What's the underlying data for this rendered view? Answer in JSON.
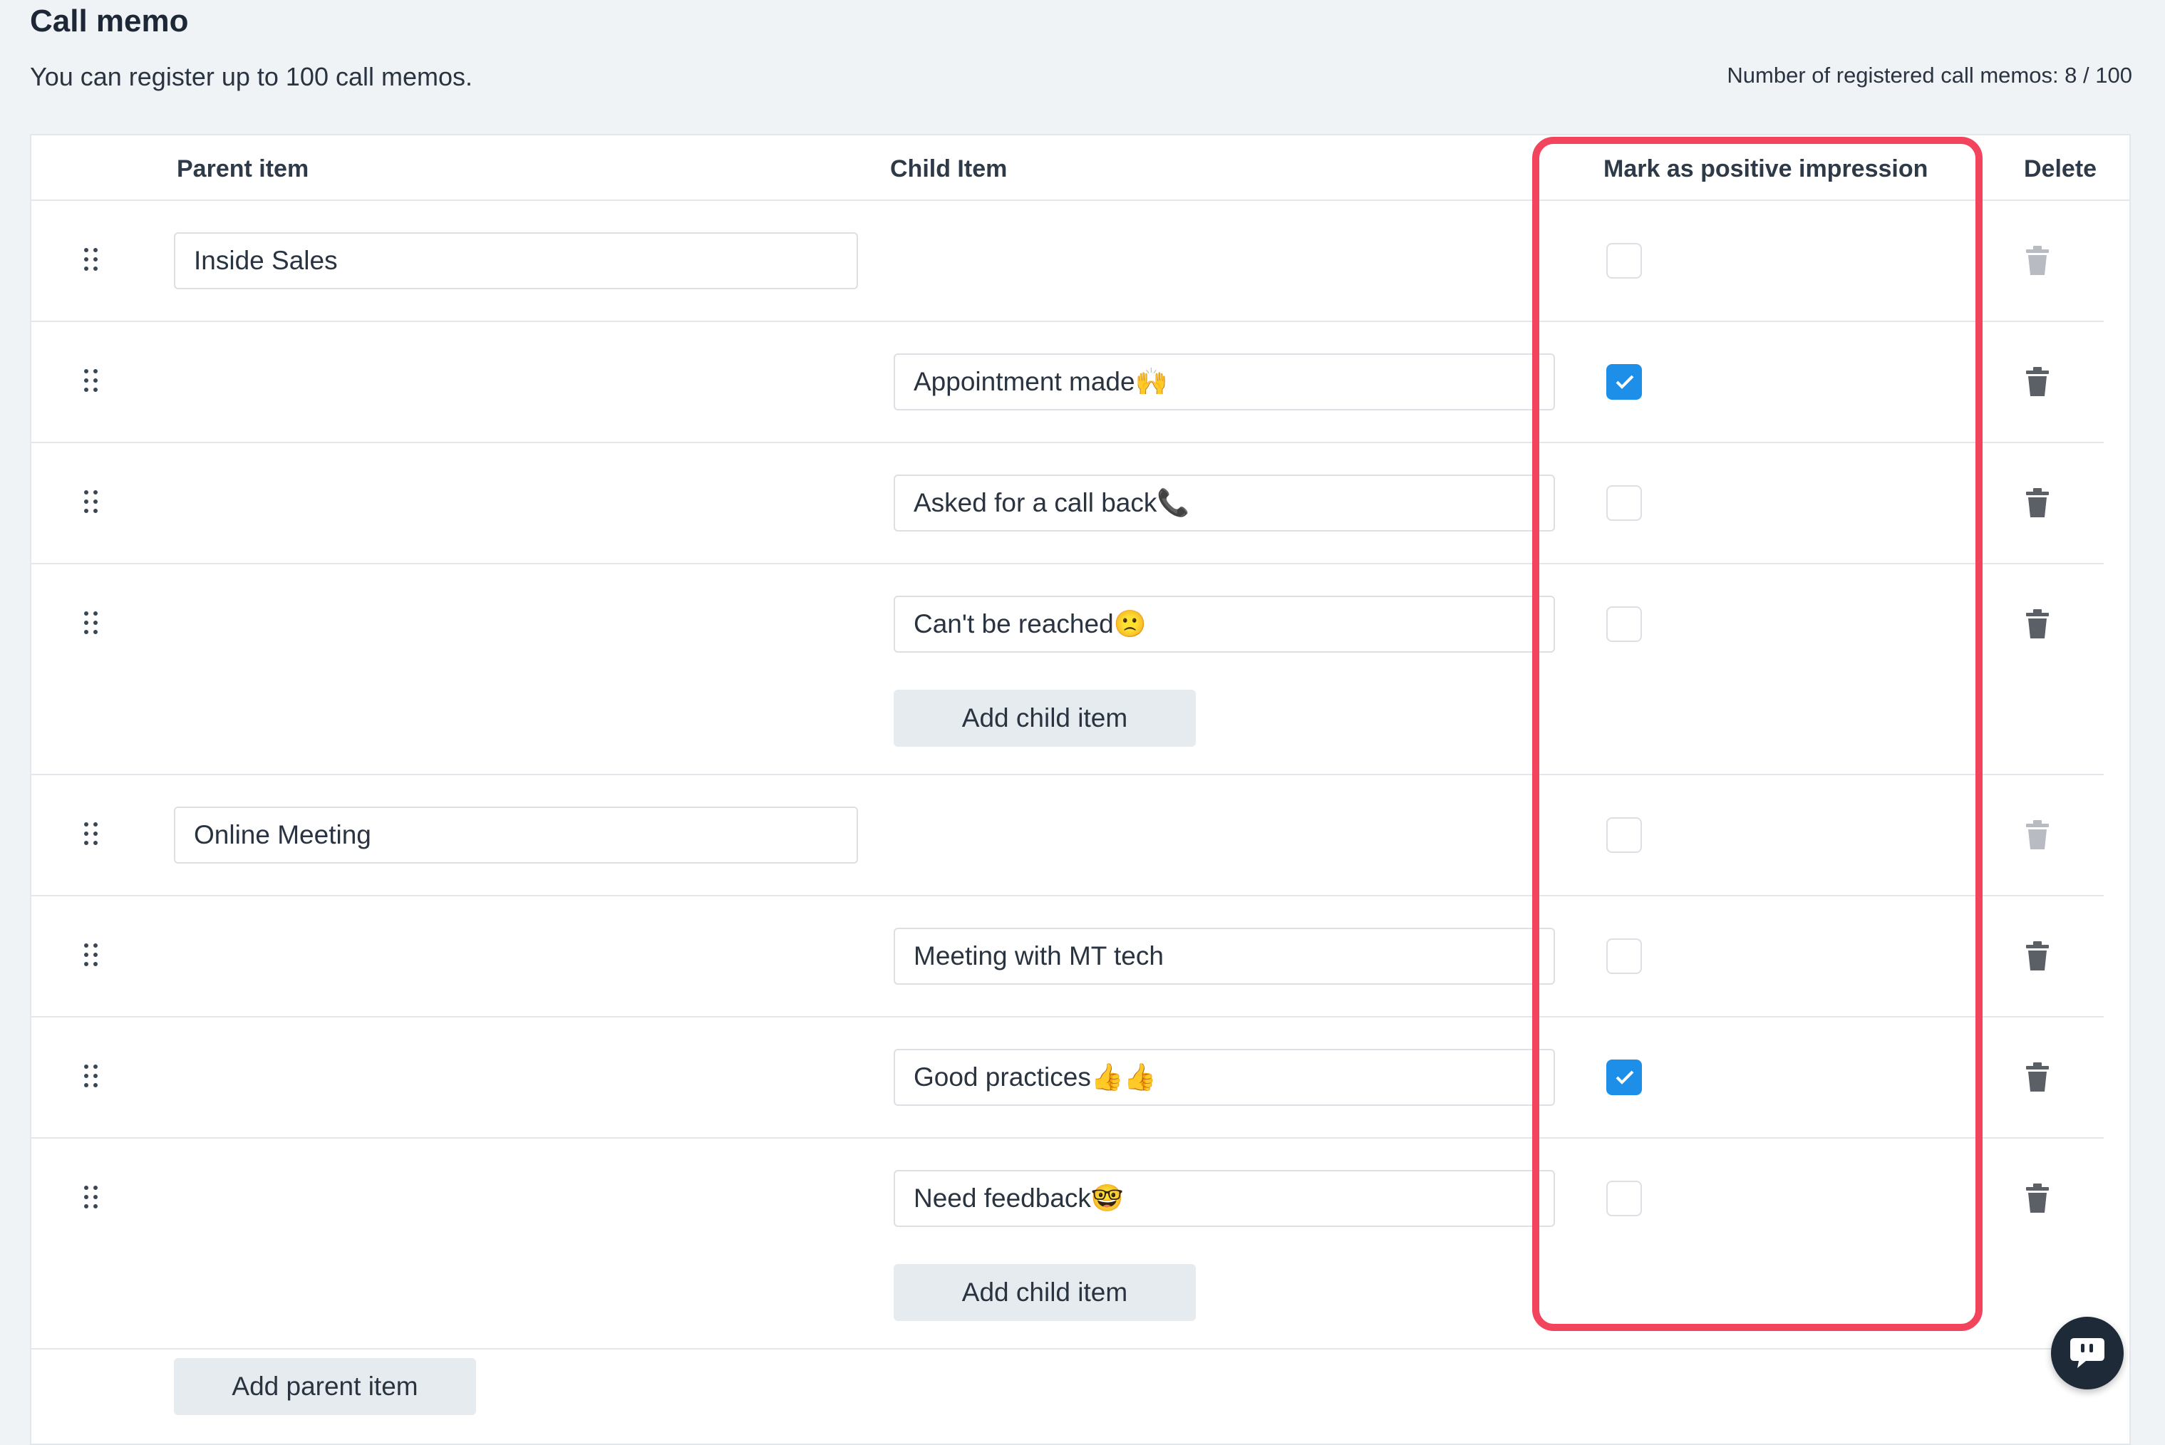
{
  "page": {
    "title": "Call memo",
    "description": "You can register up to 100 call memos.",
    "counter": "Number of registered call memos: 8 / 100"
  },
  "table": {
    "headers": {
      "parent": "Parent item",
      "child": "Child Item",
      "mark": "Mark as positive impression",
      "delete": "Delete"
    }
  },
  "groups": [
    {
      "parent": "Inside Sales",
      "children": [
        {
          "label": "Appointment made🙌",
          "positive": true
        },
        {
          "label": "Asked for a call back📞",
          "positive": false
        },
        {
          "label": "Can't be reached🙁",
          "positive": false
        }
      ]
    },
    {
      "parent": "Online Meeting",
      "children": [
        {
          "label": "Meeting with MT tech",
          "positive": false
        },
        {
          "label": "Good practices👍👍",
          "positive": true
        },
        {
          "label": "Need feedback🤓",
          "positive": false
        }
      ]
    }
  ],
  "buttons": {
    "add_child": "Add child item",
    "add_parent": "Add parent item"
  },
  "icons": {
    "drag": "drag-handle-icon",
    "trash": "trash-icon",
    "check": "check-icon",
    "chat": "chat-icon"
  },
  "colors": {
    "highlight": "#f2445c",
    "checkbox_checked": "#1e8fe8",
    "trash_active": "#5b5f66",
    "trash_disabled": "#b8bcc2"
  }
}
